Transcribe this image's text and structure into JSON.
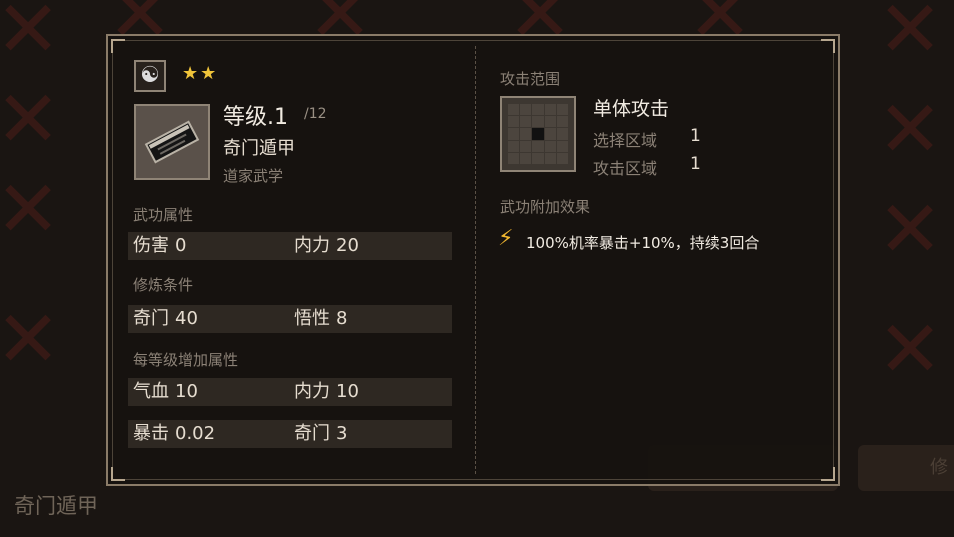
{
  "background": {
    "bottom_label": "奇门遁甲",
    "bottom_button_1": "",
    "bottom_button_2": "修"
  },
  "header": {
    "star_count": 2,
    "stars": "★★"
  },
  "skill": {
    "level": "等级.1",
    "level_max": "/12",
    "name": "奇门遁甲",
    "category": "道家武学"
  },
  "attributes": {
    "title": "武功属性",
    "row": [
      {
        "label": "伤害",
        "value": "0"
      },
      {
        "label": "内力",
        "value": "20"
      }
    ]
  },
  "requirements": {
    "title": "修炼条件",
    "row": [
      {
        "label": "奇门",
        "value": "40"
      },
      {
        "label": "悟性",
        "value": "8"
      }
    ]
  },
  "per_level": {
    "title": "每等级增加属性",
    "rows": [
      [
        {
          "label": "气血",
          "value": "10"
        },
        {
          "label": "内力",
          "value": "10"
        }
      ],
      [
        {
          "label": "暴击",
          "value": "0.02"
        },
        {
          "label": "奇门",
          "value": "3"
        }
      ]
    ]
  },
  "range": {
    "title": "攻击范围",
    "type": "单体攻击",
    "select_label": "选择区域",
    "select_value": "1",
    "attack_label": "攻击区域",
    "attack_value": "1"
  },
  "effects": {
    "title": "武功附加效果",
    "text": "100%机率暴击+10%，持续3回合"
  },
  "colors": {
    "accent_gold": "#f0c43a",
    "panel_border": "#8a7b68",
    "bg_x": "#3a1a16"
  }
}
